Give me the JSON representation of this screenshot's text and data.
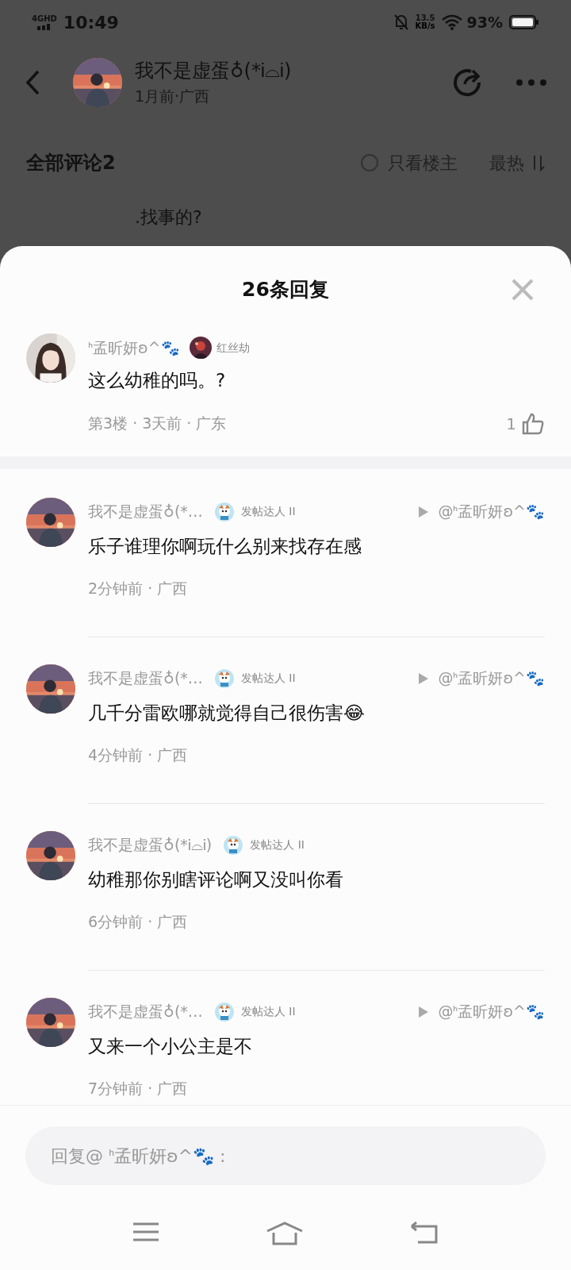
{
  "status_bar": {
    "network": "4GHD",
    "time": "10:49",
    "speed_value": "13.5",
    "speed_unit": "KB/s",
    "battery": "93%"
  },
  "post_header": {
    "author": "我不是虚蛋♁(*Ꭵ⌓Ꭵ)",
    "meta": "1月前·广西"
  },
  "comments_bar": {
    "title": "全部评论2",
    "only_op": {
      "label": "只看楼主",
      "checked": false
    },
    "sort": "最热"
  },
  "behind_comment": {
    "text": ".找事的?"
  },
  "sheet": {
    "title": "26条回复",
    "root": {
      "name": "ᑋ孟昕妍ʚ^🐾",
      "badge": "红丝劫",
      "text": "这么幼稚的吗。?",
      "meta": "第3楼 · 3天前 · 广东",
      "likes": "1"
    },
    "replies": [
      {
        "name": "我不是虚蛋♁(*…",
        "badge": "发帖达人 II",
        "reply_to": "@ᑋ孟昕妍ʚ^🐾",
        "text": "乐子谁理你啊玩什么别来找存在感",
        "meta": "2分钟前 · 广西"
      },
      {
        "name": "我不是虚蛋♁(*…",
        "badge": "发帖达人 II",
        "reply_to": "@ᑋ孟昕妍ʚ^🐾",
        "text": "几千分雷欧哪就觉得自己很伤害😂",
        "meta": "4分钟前 · 广西"
      },
      {
        "name": "我不是虚蛋♁(*Ꭵ⌓Ꭵ)",
        "badge": "发帖达人 II",
        "text": "幼稚那你别瞎评论啊又没叫你看",
        "meta": "6分钟前 · 广西"
      },
      {
        "name": "我不是虚蛋♁(*…",
        "badge": "发帖达人 II",
        "reply_to": "@ᑋ孟昕妍ʚ^🐾",
        "text": "又来一个小公主是不",
        "meta": "7分钟前 · 广西"
      }
    ],
    "reply_field": {
      "placeholder": "回复@ ᑋ孟昕妍ʚ^🐾 :"
    }
  }
}
